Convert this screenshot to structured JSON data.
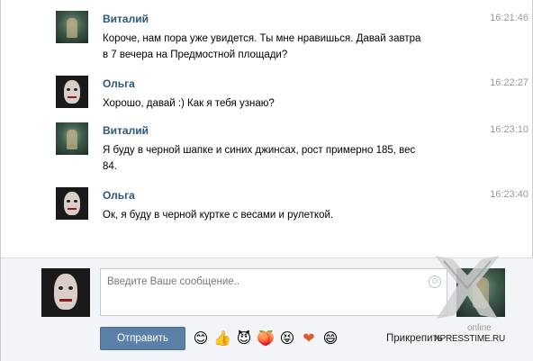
{
  "messages": [
    {
      "sender": "Виталий",
      "time": "16:21:46",
      "lines": [
        "Короче, нам пора уже увидется. Ты мне нравишься. Давай завтра",
        "в 7 вечера на Предмостной площади?"
      ],
      "avatar": "male"
    },
    {
      "sender": "Ольга",
      "time": "16:22:27",
      "lines": [
        "Хорошо, давай :) Как я тебя узнаю?"
      ],
      "avatar": "female"
    },
    {
      "sender": "Виталий",
      "time": "16:23:10",
      "lines": [
        "Я буду в черной шапке и синих джинсах, рост примерно 185, вес",
        "84."
      ],
      "avatar": "male"
    },
    {
      "sender": "Ольга",
      "time": "16:23:40",
      "lines": [
        "Ок, я буду в черной куртке с весами и рулеткой."
      ],
      "avatar": "female"
    }
  ],
  "composer": {
    "placeholder": "Введите Ваше сообщение..",
    "send_label": "Отправить",
    "attach_label": "Прикрепить",
    "status": "online",
    "smile_icon": "☺",
    "emojis": [
      "😊",
      "👍",
      "😈",
      "🍑",
      "😝",
      "❤",
      "😄"
    ]
  },
  "watermark": {
    "text": "XPRESSTIME.RU"
  },
  "colors": {
    "name": "#2b587a",
    "time": "#999999",
    "send_button": "#5b81a8",
    "composer_bg": "#f2f4f7"
  }
}
